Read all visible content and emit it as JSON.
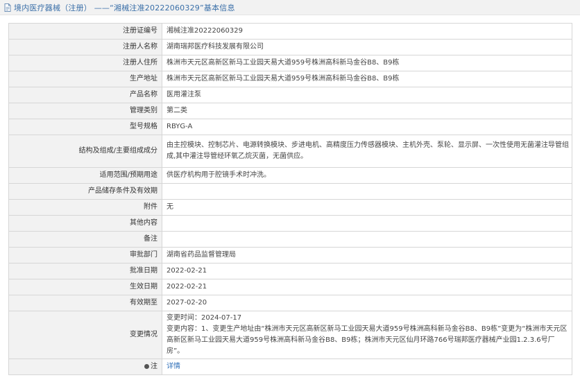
{
  "header": {
    "title": "境内医疗器械（注册） ——“湘械注准20222060329”基本信息"
  },
  "rows": [
    {
      "label": "注册证编号",
      "value": "湘械注准20222060329"
    },
    {
      "label": "注册人名称",
      "value": "湖南瑞邦医疗科技发展有限公司"
    },
    {
      "label": "注册人住所",
      "value": "株洲市天元区高新区新马工业园天易大道959号株洲高科新马金谷B8、B9栋"
    },
    {
      "label": "生产地址",
      "value": "株洲市天元区高新区新马工业园天易大道959号株洲高科新马金谷B8、B9栋"
    },
    {
      "label": "产品名称",
      "value": "医用灌注泵"
    },
    {
      "label": "管理类别",
      "value": "第二类"
    },
    {
      "label": "型号规格",
      "value": "RBYG-A"
    },
    {
      "label": "结构及组成/主要组成成分",
      "value": "由主控模块、控制芯片、电源转换模块、步进电机、高精度压力传感器模块、主机外壳、泵轮、显示屏、一次性使用无菌灌注导管组成,其中灌注导管经环氧乙烷灭菌，无菌供应。"
    },
    {
      "label": "适用范围/预期用途",
      "value": "供医疗机构用于腔镜手术时冲洗。"
    },
    {
      "label": "产品储存条件及有效期",
      "value": ""
    },
    {
      "label": "附件",
      "value": "无"
    },
    {
      "label": "其他内容",
      "value": ""
    },
    {
      "label": "备注",
      "value": ""
    },
    {
      "label": "审批部门",
      "value": "湖南省药品监督管理局"
    },
    {
      "label": "批准日期",
      "value": "2022-02-21"
    },
    {
      "label": "生效日期",
      "value": "2022-02-21"
    },
    {
      "label": "有效期至",
      "value": "2027-02-20"
    },
    {
      "label": "变更情况",
      "value": "变更时间：2024-07-17\n变更内容：1、变更生产地址由“株洲市天元区高新区新马工业园天易大道959号株洲高科新马金谷B8、B9栋”变更为“株洲市天元区高新区新马工业园天易大道959号株洲高科新马金谷B8、B9栋；株洲市天元区仙月环路766号瑞邦医疗器械产业园1.2.3.6号厂房”。"
    },
    {
      "label": "注",
      "value": "详情"
    }
  ]
}
